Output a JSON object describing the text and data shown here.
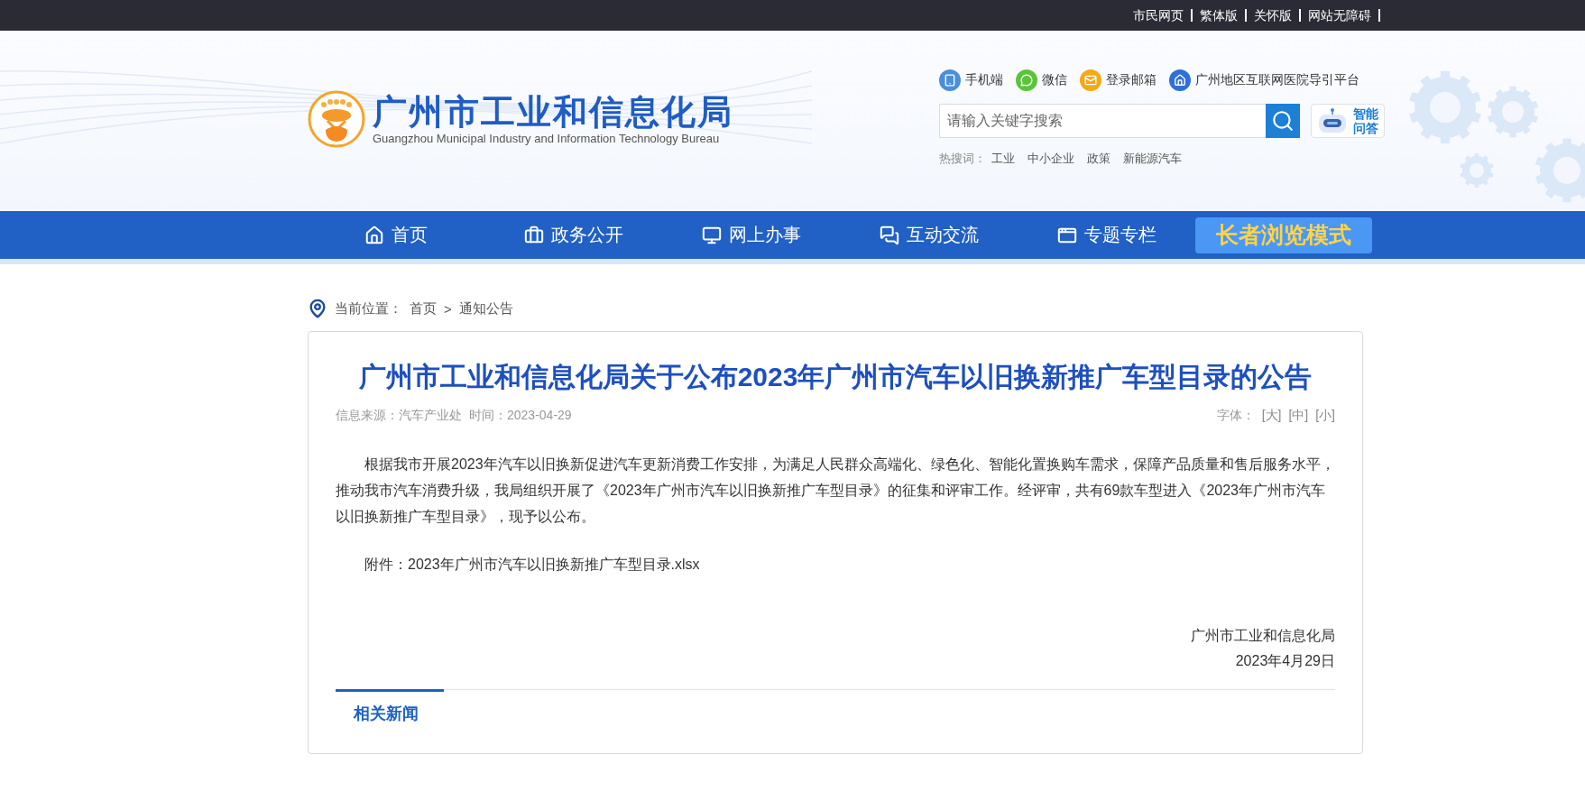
{
  "top_links": [
    "市民网页",
    "繁体版",
    "关怀版",
    "网站无障碍"
  ],
  "header": {
    "title": "广州市工业和信息化局",
    "subtitle": "Guangzhou Municipal Industry and Information Technology Bureau",
    "quick_links": [
      {
        "kind": "tablet",
        "label": "手机端",
        "color": "#4a90d9"
      },
      {
        "kind": "wechat",
        "label": "微信",
        "color": "#5ac43a"
      },
      {
        "kind": "mail",
        "label": "登录邮箱",
        "color": "#f5a914"
      },
      {
        "kind": "hospital",
        "label": "广州地区互联网医院导引平台",
        "color": "#2e6fd8"
      }
    ],
    "search": {
      "placeholder": "请输入关键字搜索"
    },
    "assistant": "智能问答",
    "hot_label": "热搜词：",
    "hot_terms": [
      "工业",
      "中小企业",
      "政策",
      "新能源汽车"
    ]
  },
  "nav": {
    "items": [
      {
        "kind": "home",
        "label": "首页"
      },
      {
        "kind": "briefcase",
        "label": "政务公开"
      },
      {
        "kind": "monitor",
        "label": "网上办事"
      },
      {
        "kind": "chat",
        "label": "互动交流"
      },
      {
        "kind": "window",
        "label": "专题专栏"
      }
    ],
    "elder_mode": "长者浏览模式"
  },
  "breadcrumb": {
    "label": "当前位置：",
    "items": [
      "首页",
      "通知公告"
    ],
    "separator": ">"
  },
  "article": {
    "title": "广州市工业和信息化局关于公布2023年广州市汽车以旧换新推广车型目录的公告",
    "source": "信息来源：汽车产业处",
    "time": "时间：2023-04-29",
    "font_label": "字体：",
    "font_options": [
      "[大]",
      "[中]",
      "[小]"
    ],
    "paragraph": "根据我市开展2023年汽车以旧换新促进汽车更新消费工作安排，为满足人民群众高端化、绿色化、智能化置换购车需求，保障产品质量和售后服务水平，推动我市汽车消费升级，我局组织开展了《2023年广州市汽车以旧换新推广车型目录》的征集和评审工作。经评审，共有69款车型进入《2023年广州市汽车以旧换新推广车型目录》，现予以公布。",
    "attachment_label": "附件：",
    "attachment": "2023年广州市汽车以旧换新推广车型目录.xlsx",
    "signature": [
      "广州市工业和信息化局",
      "2023年4月29日"
    ]
  },
  "related": {
    "tabs": [
      {
        "label": "相关新闻",
        "selected": true
      }
    ]
  }
}
